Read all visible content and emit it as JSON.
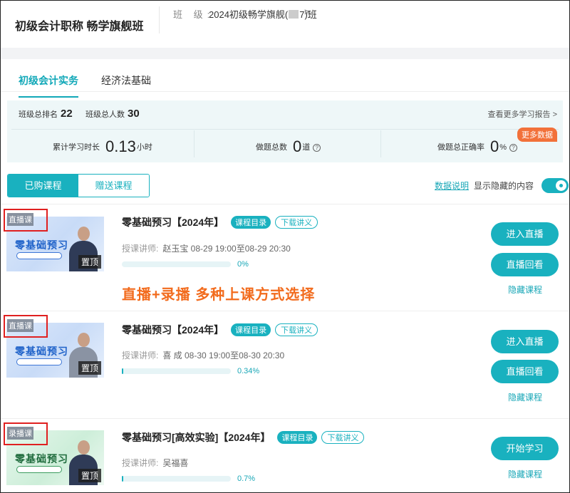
{
  "header": {
    "title": "初级会计职称 畅学旗舰班",
    "class_label": "班 级:",
    "class_value_prefix": "2024初级畅学旗舰(",
    "class_value_suffix": "7)班",
    "chevron": ">"
  },
  "subject_tabs": [
    {
      "label": "初级会计实务",
      "active": true
    },
    {
      "label": "经济法基础",
      "active": false
    }
  ],
  "stats": {
    "rank_label": "班级总排名",
    "rank_value": "22",
    "total_label": "班级总人数",
    "total_value": "30",
    "more_report": "查看更多学习报告 >",
    "study_time_label": "累计学习时长",
    "study_time_value": "0.13",
    "study_time_unit": "小时",
    "questions_label": "做题总数",
    "questions_value": "0",
    "questions_unit": "道",
    "accuracy_label": "做题总正确率",
    "accuracy_value": "0",
    "accuracy_unit": "%",
    "more_data": "更多数据",
    "help_icon": "?"
  },
  "course_tabs": [
    {
      "label": "已购课程",
      "active": true
    },
    {
      "label": "赠送课程",
      "active": false
    }
  ],
  "data_explain": "数据说明",
  "show_hidden_label": "显示隐藏的内容",
  "show_hidden_on": true,
  "promo_text": "直播+录播 多种上课方式选择",
  "courses": [
    {
      "badge": "直播课",
      "thumb_text": "零基础预习",
      "pin": "置顶",
      "title": "零基础预习【2024年】",
      "catalog_tag": "课程目录",
      "handout_tag": "下载讲义",
      "teacher_label": "授课讲师:",
      "teacher_name": "赵玉宝 08-29 19:00至08-29 20:30",
      "progress": 0,
      "progress_text": "0%",
      "buttons": [
        "进入直播",
        "直播回看"
      ],
      "hide_link": "隐藏课程"
    },
    {
      "badge": "直播课",
      "thumb_text": "零基础预习",
      "pin": "置顶",
      "title": "零基础预习【2024年】",
      "catalog_tag": "课程目录",
      "handout_tag": "下载讲义",
      "teacher_label": "授课讲师:",
      "teacher_name": "喜 成 08-30 19:00至08-30 20:30",
      "progress": 0.34,
      "progress_text": "0.34%",
      "buttons": [
        "进入直播",
        "直播回看"
      ],
      "hide_link": "隐藏课程"
    },
    {
      "badge": "录播课",
      "thumb_text": "零基础预习",
      "pin": "置顶",
      "title": "零基础预习[高效实验]【2024年】",
      "catalog_tag": "课程目录",
      "handout_tag": "下载讲义",
      "teacher_label": "授课讲师:",
      "teacher_name": "吴福喜",
      "progress": 0.7,
      "progress_text": "0.7%",
      "buttons": [
        "开始学习"
      ],
      "hide_link": "隐藏课程"
    }
  ],
  "colors": {
    "accent": "#19b1bf",
    "promo": "#f26b1d",
    "badge_outline": "#e02020",
    "more_data_bg": "#f2713a"
  }
}
